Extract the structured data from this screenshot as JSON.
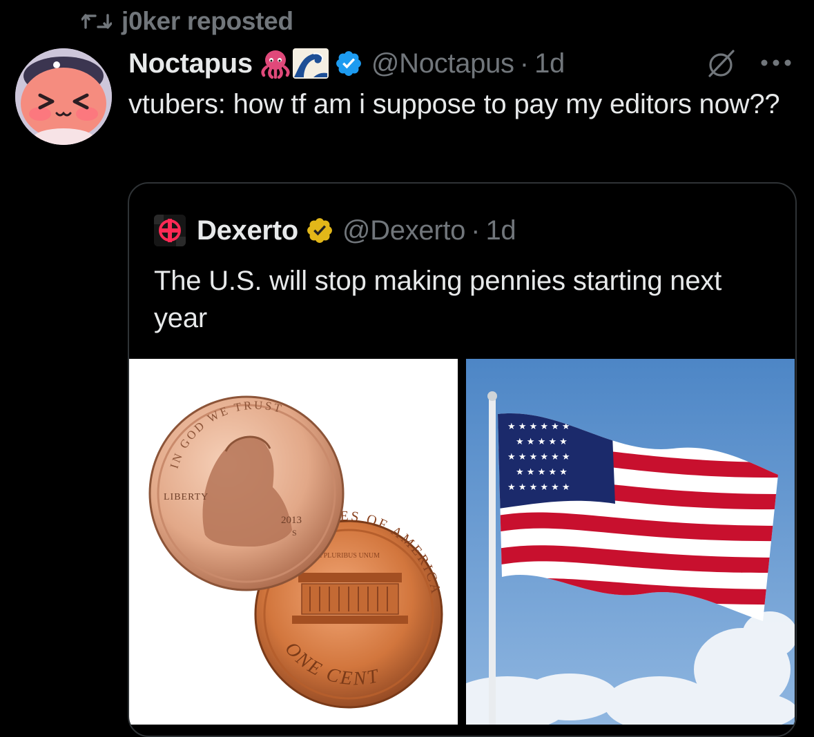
{
  "repost": {
    "label": "j0ker reposted"
  },
  "tweet": {
    "author_name": "Noctapus",
    "author_emojis": "🐙🌊",
    "handle": "@Noctapus",
    "separator": "·",
    "time": "1d",
    "text": "vtubers: how tf am i suppose to pay my editors now??"
  },
  "quote": {
    "author_name": "Dexerto",
    "handle": "@Dexerto",
    "separator": "·",
    "time": "1d",
    "text": "The U.S. will stop making pennies starting next year",
    "penny": {
      "motto": "IN GOD WE TRUST",
      "liberty": "LIBERTY",
      "year": "2013",
      "mint_mark": "S",
      "reverse_top": "STATES OF AMERICA",
      "pluribus": "E PLURIBUS UNUM",
      "denomination": "ONE CENT"
    }
  },
  "colors": {
    "background": "#000000",
    "text": "#e7e9ea",
    "muted": "#71767b",
    "verified_blue": "#1d9bf0",
    "verified_gold": "#e2b719",
    "border": "#2f3336"
  },
  "icons": [
    "repost-icon",
    "verified-badge-icon",
    "grok-icon",
    "more-icon",
    "gold-verified-badge-icon"
  ]
}
